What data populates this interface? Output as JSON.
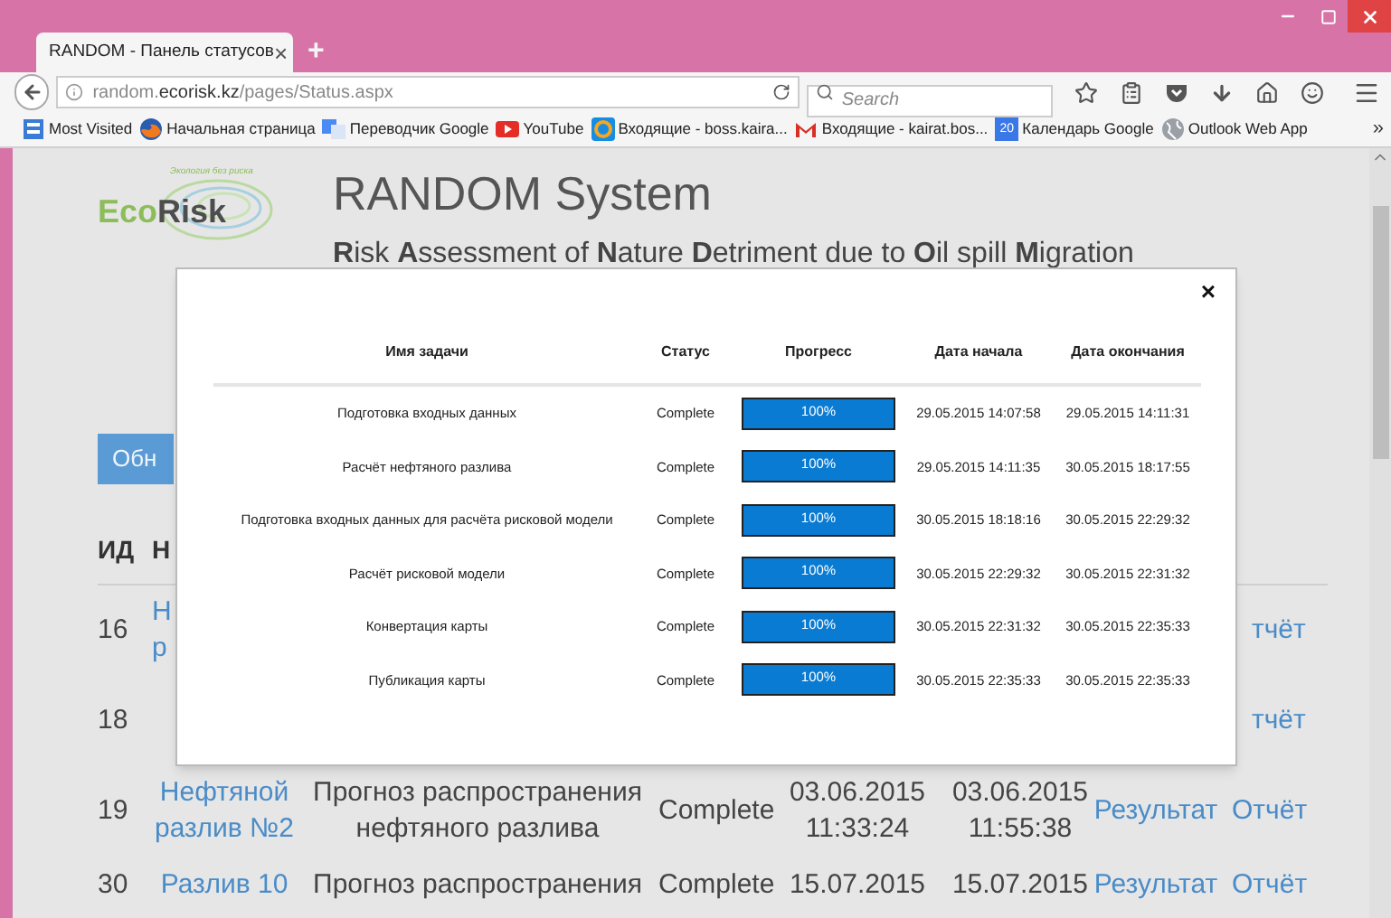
{
  "browser": {
    "tab": {
      "title": "RANDOM - Панель статусов",
      "close": "×",
      "selected": true
    },
    "new_tab": "+",
    "address": {
      "prefix": "random.",
      "domain": "ecorisk.kz",
      "path": "/pages/Status.aspx"
    },
    "search": {
      "placeholder": "Search"
    },
    "bookmarks": [
      {
        "label": "Most Visited",
        "kind": "page"
      },
      {
        "label": "Начальная страница",
        "kind": "firefox"
      },
      {
        "label": "Переводчик Google",
        "kind": "translate"
      },
      {
        "label": "YouTube",
        "kind": "youtube"
      },
      {
        "label": "Входящие - boss.kaira...",
        "kind": "mailru"
      },
      {
        "label": "Входящие - kairat.bos...",
        "kind": "gmail"
      },
      {
        "label": "Календарь Google",
        "kind": "calendar",
        "icon_text": "20"
      },
      {
        "label": "Outlook Web App",
        "kind": "globe"
      }
    ],
    "overflow": "»"
  },
  "page": {
    "logo": {
      "tagline": "Экология без риска",
      "eco": "Eco",
      "risk": "Risk"
    },
    "title": "RANDOM System",
    "subtitle": "**R**isk **A**ssessment of **N**ature **D**etriment due to **O**il spill **M**igration",
    "refresh_button": "Обн",
    "table": {
      "columns": [
        "ИД",
        "Н"
      ],
      "rows": [
        {
          "kind": "covered",
          "id": "16",
          "name": [
            "Н",
            "р"
          ],
          "report": "тчёт"
        },
        {
          "kind": "covered",
          "id": "18",
          "report": "тчёт"
        },
        {
          "kind": "full",
          "id": "19",
          "name": [
            "Нефтяной",
            "разлив №2"
          ],
          "task": [
            "Прогноз распространения",
            "нефтяного разлива"
          ],
          "status": "Complete",
          "start": [
            "03.06.2015",
            "11:33:24"
          ],
          "end": [
            "03.06.2015",
            "11:55:38"
          ],
          "result": "Результат",
          "report": "Отчёт"
        },
        {
          "kind": "full",
          "id": "30",
          "name": [
            "Разлив 10"
          ],
          "task": [
            "Прогноз распространения"
          ],
          "status": "Complete",
          "start": [
            "15.07.2015"
          ],
          "end": [
            "15.07.2015"
          ],
          "result": "Результат",
          "report": "Отчёт"
        }
      ]
    }
  },
  "modal": {
    "close": "×",
    "columns": [
      "Имя задачи",
      "Статус",
      "Прогресс",
      "Дата начала",
      "Дата окончания"
    ],
    "rows": [
      {
        "task": "Подготовка входных данных",
        "status": "Complete",
        "level": 1,
        "progress": "100%",
        "start": "29.05.2015 14:07:58",
        "end": "29.05.2015 14:11:31"
      },
      {
        "task": "Расчёт нефтяного разлива",
        "status": "Complete",
        "level": 1,
        "progress": "100%",
        "start": "29.05.2015 14:11:35",
        "end": "30.05.2015 18:17:55"
      },
      {
        "task": "Подготовка входных данных для расчёта рисковой модели",
        "status": "Complete",
        "level": 1,
        "progress": "100%",
        "start": "30.05.2015 18:18:16",
        "end": "30.05.2015 22:29:32"
      },
      {
        "task": "Расчёт рисковой модели",
        "status": "Complete",
        "level": 1,
        "progress": "100%",
        "start": "30.05.2015 22:29:32",
        "end": "30.05.2015 22:31:32"
      },
      {
        "task": "Конвертация карты",
        "status": "Complete",
        "level": 1,
        "progress": "100%",
        "start": "30.05.2015 22:31:32",
        "end": "30.05.2015 22:35:33"
      },
      {
        "task": "Публикация карты",
        "status": "Complete",
        "level": 1,
        "progress": "100%",
        "start": "30.05.2015 22:35:33",
        "end": "30.05.2015 22:35:33"
      }
    ]
  }
}
